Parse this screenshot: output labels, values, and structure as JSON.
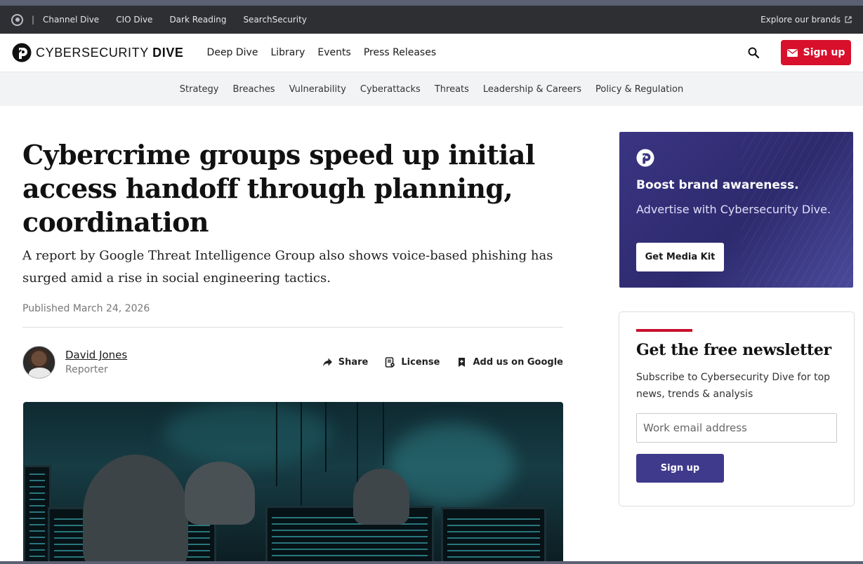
{
  "network_bar": {
    "links": [
      "Channel Dive",
      "CIO Dive",
      "Dark Reading",
      "SearchSecurity"
    ],
    "separator": "|",
    "explore_label": "Explore our brands"
  },
  "header": {
    "brand_light": "CYBERSECURITY",
    "brand_bold": "DIVE",
    "nav": [
      "Deep Dive",
      "Library",
      "Events",
      "Press Releases"
    ],
    "signup_label": "Sign up",
    "accent_color": "#d8102c"
  },
  "topics": [
    "Strategy",
    "Breaches",
    "Vulnerability",
    "Cyberattacks",
    "Threats",
    "Leadership & Careers",
    "Policy & Regulation"
  ],
  "article": {
    "headline": "Cybercrime groups speed up initial access handoff through planning, coordination",
    "dek": "A report by Google Threat Intelligence Group also shows voice-based phishing has surged amid a rise in social engineering tactics.",
    "published": "Published March 24, 2026",
    "author_name": "David Jones",
    "author_role": "Reporter",
    "actions": {
      "share": "Share",
      "license": "License",
      "google": "Add us on Google"
    }
  },
  "ad": {
    "title": "Boost brand awareness.",
    "subtitle": "Advertise with Cybersecurity Dive.",
    "button": "Get Media Kit",
    "color": "#3b3582"
  },
  "newsletter": {
    "title": "Get the free newsletter",
    "text": "Subscribe to Cybersecurity Dive for top news, trends & analysis",
    "placeholder": "Work email address",
    "button": "Sign up",
    "accent_color": "#c8102e",
    "button_color": "#3f3a8c"
  }
}
